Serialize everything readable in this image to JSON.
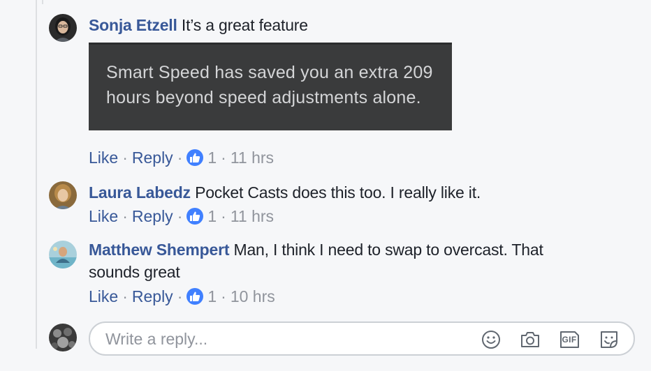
{
  "comments": [
    {
      "author": "Sonja Etzell",
      "text": "It’s a great feature",
      "attachment_text": "Smart Speed has saved you an extra 209 hours beyond speed adjustments alone.",
      "actions": {
        "like": "Like",
        "reply": "Reply",
        "likes_count": "1",
        "time": "11 hrs"
      },
      "avatar_icon": "person-avatar-icon"
    },
    {
      "author": "Laura Labedz",
      "text": "Pocket Casts does this too. I really like it.",
      "actions": {
        "like": "Like",
        "reply": "Reply",
        "likes_count": "1",
        "time": "11 hrs"
      },
      "avatar_icon": "person-avatar-icon"
    },
    {
      "author": "Matthew Shempert",
      "text_line1": "Man, I think I need to swap to overcast. That",
      "text_line2": "sounds great",
      "actions": {
        "like": "Like",
        "reply": "Reply",
        "likes_count": "1",
        "time": "10 hrs"
      },
      "avatar_icon": "person-avatar-icon"
    }
  ],
  "separator": "·",
  "reply_box": {
    "placeholder": "Write a reply...",
    "icons": [
      "emoji-icon",
      "camera-icon",
      "gif-icon",
      "sticker-icon"
    ],
    "gif_label": "GIF"
  },
  "colors": {
    "link": "#385898",
    "meta": "#90949c",
    "like_badge": "#4080ff",
    "background": "#f6f7f9"
  }
}
